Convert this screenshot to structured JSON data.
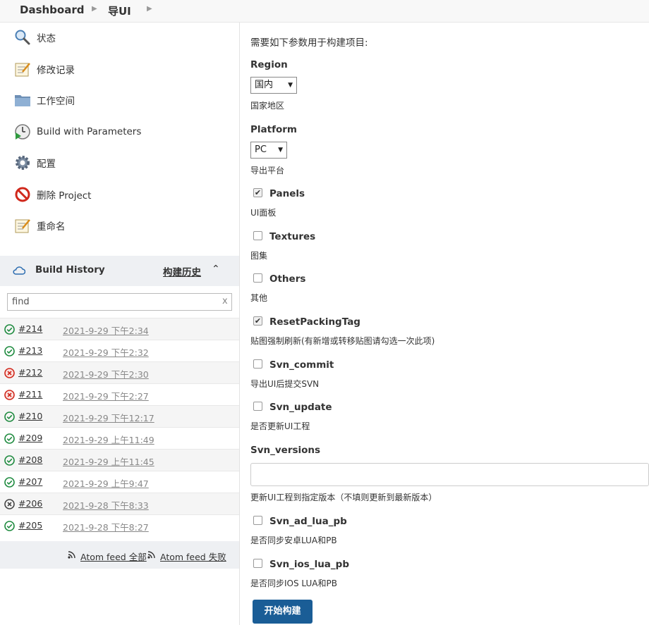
{
  "breadcrumb": {
    "items": [
      {
        "label": "Dashboard"
      },
      {
        "label": "导UI"
      }
    ]
  },
  "side_nav": {
    "items": [
      {
        "label": "状态",
        "icon": "search-icon"
      },
      {
        "label": "修改记录",
        "icon": "notepad-icon"
      },
      {
        "label": "工作空间",
        "icon": "folder-icon"
      },
      {
        "label": "Build with Parameters",
        "icon": "clock-play-icon"
      },
      {
        "label": "配置",
        "icon": "gear-icon"
      },
      {
        "label": "删除 Project",
        "icon": "no-entry-icon"
      },
      {
        "label": "重命名",
        "icon": "notepad-icon"
      }
    ]
  },
  "build_history": {
    "title": "Build History",
    "title_zh": "构建历史",
    "collapse_glyph": "⌃",
    "search": {
      "value": "find",
      "clear_glyph": "x"
    },
    "builds": [
      {
        "num": "#214",
        "date": "2021-9-29 下午2:34",
        "status": "success"
      },
      {
        "num": "#213",
        "date": "2021-9-29 下午2:32",
        "status": "success"
      },
      {
        "num": "#212",
        "date": "2021-9-29 下午2:30",
        "status": "failed"
      },
      {
        "num": "#211",
        "date": "2021-9-29 下午2:27",
        "status": "failed"
      },
      {
        "num": "#210",
        "date": "2021-9-29 下午12:17",
        "status": "success"
      },
      {
        "num": "#209",
        "date": "2021-9-29 上午11:49",
        "status": "success"
      },
      {
        "num": "#208",
        "date": "2021-9-29 上午11:45",
        "status": "success"
      },
      {
        "num": "#207",
        "date": "2021-9-29 上午9:47",
        "status": "success"
      },
      {
        "num": "#206",
        "date": "2021-9-28 下午8:33",
        "status": "aborted"
      },
      {
        "num": "#205",
        "date": "2021-9-28 下午8:27",
        "status": "success"
      }
    ],
    "feeds": [
      {
        "label": "Atom feed 全部"
      },
      {
        "label": "Atom feed 失败"
      }
    ]
  },
  "form": {
    "intro": "需要如下参数用于构建项目:",
    "params": {
      "region": {
        "name": "Region",
        "value": "国内",
        "desc": "国家地区"
      },
      "platform": {
        "name": "Platform",
        "value": "PC",
        "desc": "导出平台"
      },
      "panels": {
        "name": "Panels",
        "checked": true,
        "desc": "UI面板"
      },
      "textures": {
        "name": "Textures",
        "checked": false,
        "desc": "图集"
      },
      "others": {
        "name": "Others",
        "checked": false,
        "desc": "其他"
      },
      "reset_packing_tag": {
        "name": "ResetPackingTag",
        "checked": true,
        "desc": "贴图强制刷新(有新增或转移贴图请勾选一次此项)"
      },
      "svn_commit": {
        "name": "Svn_commit",
        "checked": false,
        "desc": "导出UI后提交SVN"
      },
      "svn_update": {
        "name": "Svn_update",
        "checked": false,
        "desc": "是否更新UI工程"
      },
      "svn_versions": {
        "name": "Svn_versions",
        "value": "",
        "desc": "更新UI工程到指定版本（不填则更新到最新版本）"
      },
      "svn_ad_lua_pb": {
        "name": "Svn_ad_lua_pb",
        "checked": false,
        "desc": "是否同步安卓LUA和PB"
      },
      "svn_ios_lua_pb": {
        "name": "Svn_ios_lua_pb",
        "checked": false,
        "desc": "是否同步IOS LUA和PB"
      }
    },
    "submit_label": "开始构建"
  },
  "colors": {
    "success": "#1d8a3e",
    "failed": "#d0281c",
    "aborted": "#444444",
    "primary_button": "#1a5d96",
    "panel_bg": "#eef0f3"
  }
}
